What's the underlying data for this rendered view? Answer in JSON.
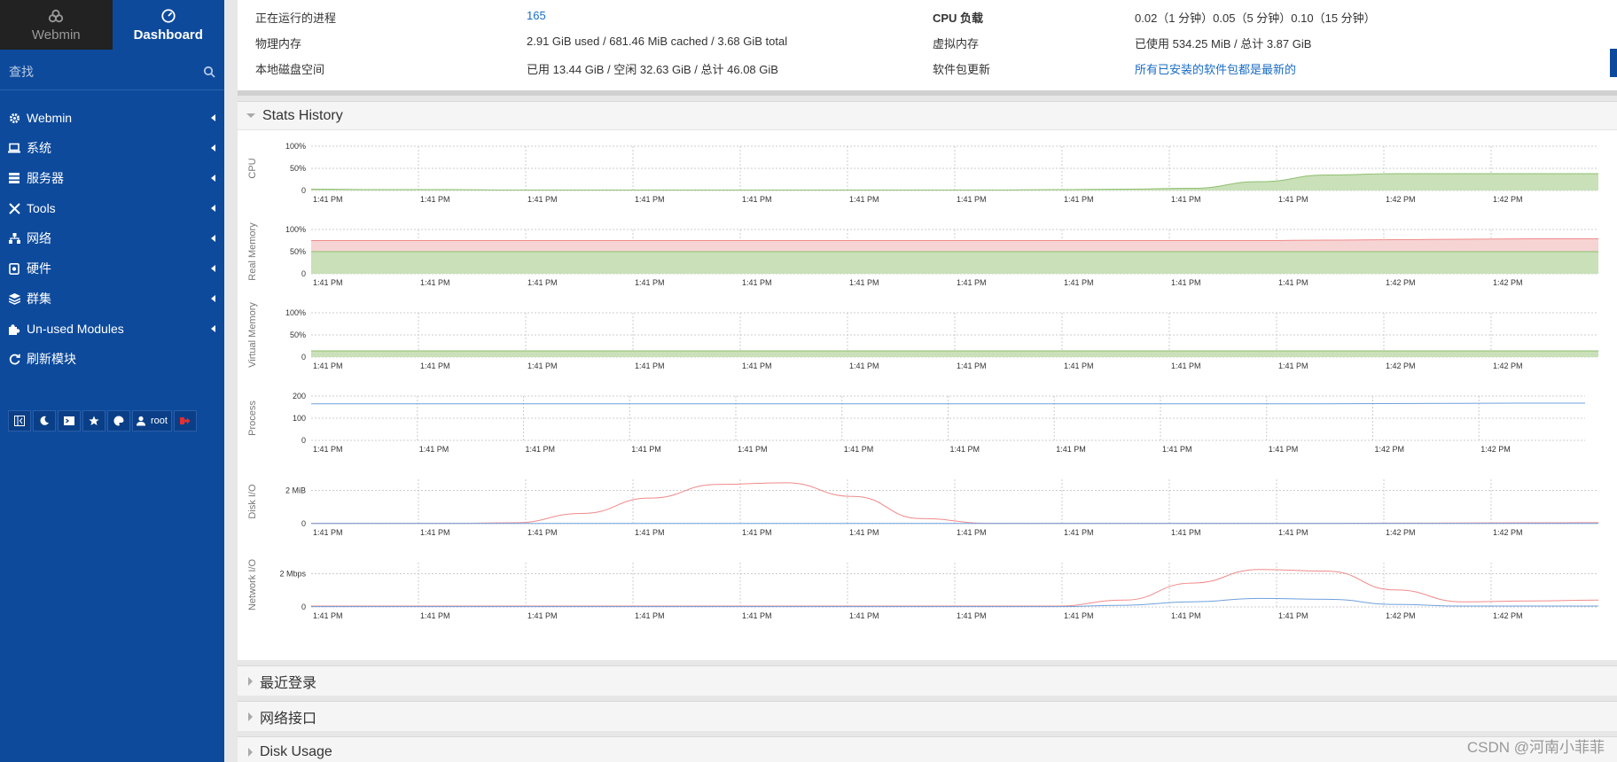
{
  "sidebar": {
    "tabs": [
      {
        "label": "Webmin",
        "icon": "webmin-logo-icon"
      },
      {
        "label": "Dashboard",
        "icon": "dashboard-icon"
      }
    ],
    "search": {
      "placeholder": "查找"
    },
    "items": [
      {
        "label": "Webmin",
        "icon": "gear-icon"
      },
      {
        "label": "系统",
        "icon": "laptop-icon"
      },
      {
        "label": "服务器",
        "icon": "server-icon"
      },
      {
        "label": "Tools",
        "icon": "tools-icon"
      },
      {
        "label": "网络",
        "icon": "network-icon"
      },
      {
        "label": "硬件",
        "icon": "hardware-icon"
      },
      {
        "label": "群集",
        "icon": "cluster-icon"
      },
      {
        "label": "Un-used Modules",
        "icon": "puzzle-icon"
      },
      {
        "label": "刷新模块",
        "icon": "refresh-icon"
      }
    ],
    "toolbar": {
      "user": "root"
    }
  },
  "sysinfo": {
    "rows": [
      {
        "k1": "正在运行的进程",
        "v1": "165",
        "k2": "CPU 负载",
        "v2": "0.02（1 分钟）0.05（5 分钟）0.10（15 分钟）"
      },
      {
        "k1": "物理内存",
        "v1": "2.91 GiB used / 681.46 MiB cached / 3.68 GiB total",
        "k2": "虚拟内存",
        "v2": "已使用 534.25 MiB / 总计 3.87 GiB"
      },
      {
        "k1": "本地磁盘空间",
        "v1": "已用 13.44 GiB / 空闲 32.63 GiB / 总计 46.08 GiB",
        "k2": "软件包更新",
        "v2": "所有已安装的软件包都是最新的"
      }
    ]
  },
  "stats": {
    "title": "Stats History",
    "x_ticks": [
      "1:41 PM",
      "1:41 PM",
      "1:41 PM",
      "1:41 PM",
      "1:41 PM",
      "1:41 PM",
      "1:41 PM",
      "1:41 PM",
      "1:41 PM",
      "1:41 PM",
      "1:42 PM",
      "1:42 PM"
    ],
    "process_x_ticks": [
      "1:41 PM",
      "1:41 PM",
      "1:41 PM",
      "1:41 PM",
      "1:41 PM",
      "1:41 PM",
      "1:41 PM",
      "1:41 PM",
      "1:41 PM",
      "1:41 PM",
      "1:42 PM",
      "1:42 PM"
    ]
  },
  "panels": [
    "最近登录",
    "网络接口",
    "Disk Usage"
  ],
  "watermark": "CSDN @河南小菲菲",
  "colors": {
    "sidebar": "#0d4a9c",
    "green_fill": "#c9e0b8",
    "green_line": "#8fbf70",
    "red_fill": "#f6d4d4",
    "red_line": "#f08a8a",
    "blue_line": "#6fa0dc"
  },
  "chart_data": [
    {
      "type": "area",
      "ylabel": "CPU",
      "yticks": [
        "100%",
        "50%",
        "0"
      ],
      "ylim": [
        0,
        100
      ],
      "series": [
        {
          "color": "green",
          "values": [
            3,
            2,
            2,
            1,
            1,
            1,
            1,
            1,
            1,
            1,
            1,
            2,
            3,
            5,
            20,
            35,
            38,
            38,
            38,
            38
          ]
        }
      ]
    },
    {
      "type": "area",
      "ylabel": "Real Memory",
      "yticks": [
        "100%",
        "50%",
        "0"
      ],
      "ylim": [
        0,
        100
      ],
      "series": [
        {
          "color": "green",
          "values": [
            50,
            50,
            50,
            50,
            50,
            50,
            50,
            50,
            50,
            50,
            50,
            50,
            50,
            50,
            50,
            50,
            50,
            50,
            50,
            50
          ]
        },
        {
          "color": "red",
          "values": [
            75,
            75,
            75,
            75,
            75,
            75,
            75,
            75,
            75,
            75,
            75,
            75,
            75,
            75,
            75,
            76,
            77,
            78,
            79,
            79
          ]
        }
      ]
    },
    {
      "type": "area",
      "ylabel": "Virtual Memory",
      "yticks": [
        "100%",
        "50%",
        "0"
      ],
      "ylim": [
        0,
        100
      ],
      "series": [
        {
          "color": "green",
          "values": [
            14,
            14,
            14,
            14,
            14,
            14,
            14,
            14,
            14,
            14,
            14,
            14,
            14,
            14,
            14,
            14,
            14,
            14,
            14,
            14
          ]
        }
      ]
    },
    {
      "type": "line",
      "ylabel": "Process",
      "yticks": [
        "200",
        "100",
        "0"
      ],
      "ylim": [
        0,
        200
      ],
      "series": [
        {
          "color": "blue",
          "values": [
            165,
            165,
            165,
            165,
            165,
            165,
            165,
            165,
            165,
            165,
            165,
            165,
            165,
            165,
            165,
            165,
            166,
            167,
            168,
            168
          ]
        }
      ]
    },
    {
      "type": "line",
      "ylabel": "Disk I/O",
      "yticks": [
        "2 MiB",
        "0"
      ],
      "ylim": [
        0,
        2.6
      ],
      "series": [
        {
          "color": "red",
          "values": [
            0.02,
            0.02,
            0.02,
            0.05,
            0.6,
            1.5,
            2.3,
            2.4,
            1.6,
            0.3,
            0.02,
            0.02,
            0.02,
            0.02,
            0.02,
            0.02,
            0.03,
            0.04,
            0.05,
            0.06
          ]
        },
        {
          "color": "blue",
          "values": [
            0.01,
            0.01,
            0.01,
            0.01,
            0.01,
            0.01,
            0.01,
            0.01,
            0.01,
            0.01,
            0.01,
            0.01,
            0.01,
            0.01,
            0.01,
            0.01,
            0.01,
            0.01,
            0.01,
            0.01
          ]
        }
      ]
    },
    {
      "type": "line",
      "ylabel": "Network I/O",
      "yticks": [
        "2 Mbps",
        "0"
      ],
      "ylim": [
        0,
        2.6
      ],
      "series": [
        {
          "color": "red",
          "values": [
            0.05,
            0.05,
            0.05,
            0.05,
            0.05,
            0.05,
            0.05,
            0.05,
            0.05,
            0.05,
            0.05,
            0.05,
            0.4,
            1.4,
            2.2,
            2.1,
            1.0,
            0.3,
            0.35,
            0.4
          ]
        },
        {
          "color": "blue",
          "values": [
            0.02,
            0.02,
            0.02,
            0.02,
            0.02,
            0.02,
            0.02,
            0.02,
            0.02,
            0.02,
            0.02,
            0.02,
            0.1,
            0.3,
            0.5,
            0.45,
            0.15,
            0.05,
            0.05,
            0.05
          ]
        }
      ]
    }
  ]
}
